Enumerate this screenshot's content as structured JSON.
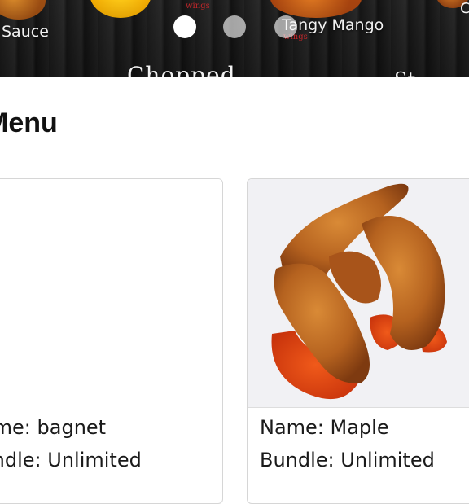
{
  "banner": {
    "labels": {
      "left": "Sauce",
      "mango": "Tangy Mango",
      "chopped": "Chopped",
      "right_partial": "St",
      "wings_a": "wings",
      "wings_b": "wings",
      "edge": "C"
    },
    "dots": [
      {
        "label": "slide 1",
        "active": true
      },
      {
        "label": "slide 2",
        "active": false
      },
      {
        "label": "slide 3",
        "active": false
      }
    ]
  },
  "menu": {
    "heading": "Menu",
    "items": [
      {
        "name_line": "Name: bagnet",
        "bundle_line": "Bundle: Unlimited",
        "has_image": false
      },
      {
        "name_line": "Name: Maple",
        "bundle_line": "Bundle: Unlimited",
        "has_image": true
      }
    ]
  }
}
